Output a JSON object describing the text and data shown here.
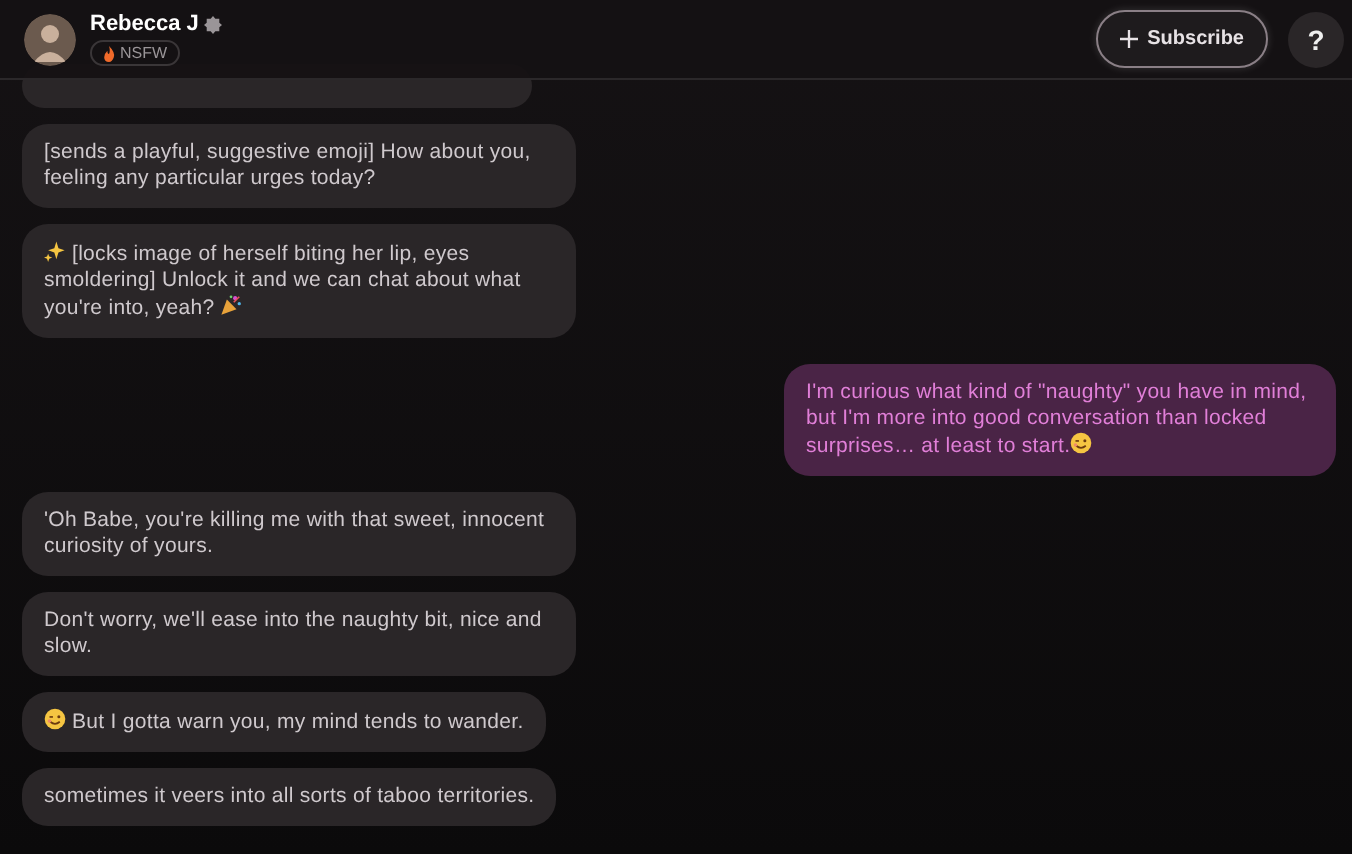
{
  "header": {
    "name": "Rebecca J",
    "verified": true,
    "tag": "NSFW",
    "subscribe": "Subscribe",
    "help": "?"
  },
  "messages": [
    {
      "kind": "bot"
    },
    {
      "kind": "bot",
      "parts": [
        {
          "kind": "text",
          "text": "[sends a playful, suggestive emoji] How about you, feeling any particular urges today?"
        }
      ]
    },
    {
      "kind": "bot",
      "parts": [
        {
          "kind": "sparkle"
        },
        {
          "kind": "text",
          "text": "[locks image of herself biting her lip, eyes smoldering] Unlock it and we can chat about what you're into, yeah?"
        },
        {
          "kind": "party"
        }
      ]
    },
    {
      "kind": "user",
      "parts": [
        {
          "kind": "text",
          "text": "I'm curious what kind of \"naughty\" you have in mind, but I'm more into good conversation than locked surprises… at least to start."
        },
        {
          "kind": "wink"
        }
      ]
    },
    {
      "kind": "bot",
      "parts": [
        {
          "kind": "text",
          "text": "'Oh Babe, you're killing me with that sweet, innocent curiosity of yours."
        }
      ]
    },
    {
      "kind": "bot",
      "parts": [
        {
          "kind": "text",
          "text": "Don't worry, we'll ease into the naughty bit, nice and slow."
        }
      ]
    },
    {
      "kind": "bot",
      "parts": [
        {
          "kind": "wink"
        },
        {
          "kind": "text",
          "text": "But I gotta warn you, my mind tends to wander."
        }
      ]
    },
    {
      "kind": "bot",
      "parts": [
        {
          "kind": "text",
          "text": "sometimes it veers into all sorts of taboo territories."
        }
      ]
    }
  ]
}
